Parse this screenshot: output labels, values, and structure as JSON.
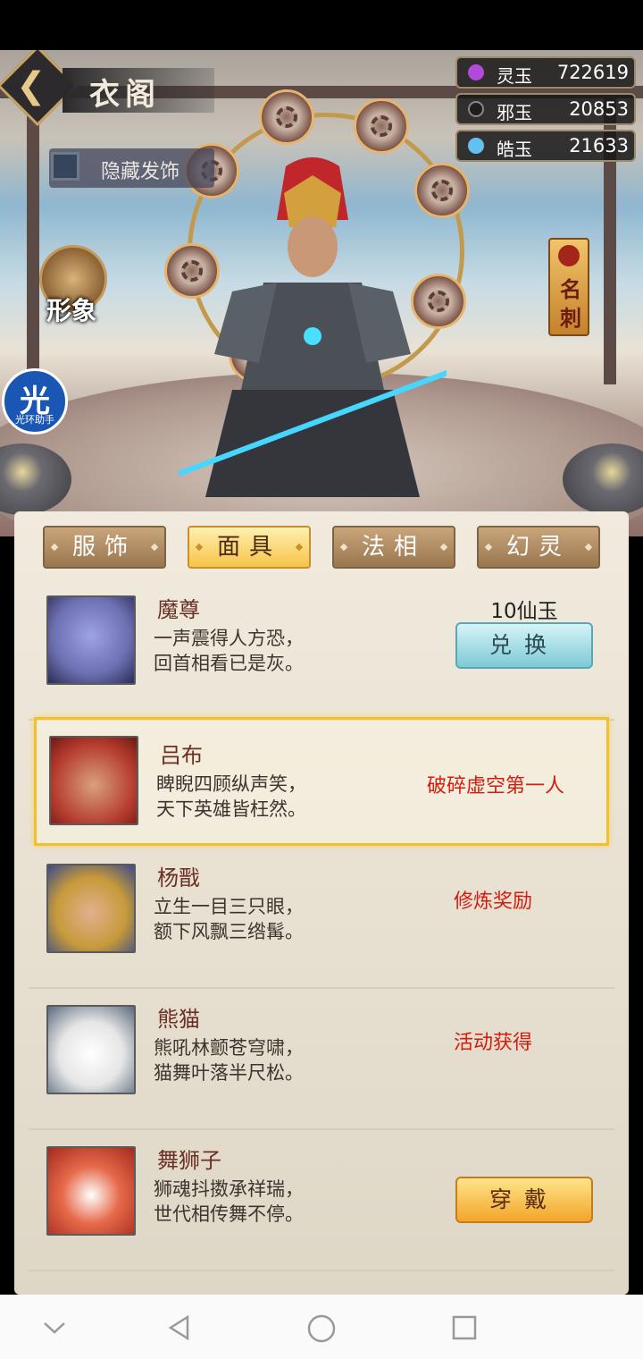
{
  "header": {
    "title": "衣阁",
    "hide_hair_label": "隐藏发饰",
    "resources": [
      {
        "name": "灵玉",
        "value": "722619",
        "icon": "purple-orb-icon",
        "color": "#b14ad8"
      },
      {
        "name": "邪玉",
        "value": "20853",
        "icon": "dark-jade-icon",
        "color": "#1e1e1e"
      },
      {
        "name": "皓玉",
        "value": "21633",
        "icon": "blue-jade-icon",
        "color": "#62c1f1"
      }
    ],
    "portrait_label": "形象",
    "card_label": "名刺",
    "helper_glyph": "光",
    "helper_label": "光环助手"
  },
  "tabs": [
    {
      "label": "服饰",
      "active": false
    },
    {
      "label": "面具",
      "active": true
    },
    {
      "label": "法相",
      "active": false
    },
    {
      "label": "幻灵",
      "active": false
    }
  ],
  "masks": [
    {
      "name": "魔尊",
      "line1": "一声震得人方恐，",
      "line2": "回首相看已是灰。",
      "price": "10仙玉",
      "button": "兑换",
      "avatar_color": "#7e84c9"
    },
    {
      "name": "吕布",
      "line1": "睥睨四顾纵声笑，",
      "line2": "天下英雄皆枉然。",
      "source": "破碎虚空第一人",
      "avatar_color": "#b43a2d"
    },
    {
      "name": "杨戬",
      "line1": "立生一目三只眼，",
      "line2": "额下风飘三绺髯。",
      "source": "修炼奖励",
      "avatar_color": "#c79a3a"
    },
    {
      "name": "熊猫",
      "line1": "熊吼林颤苍穹啸，",
      "line2": "猫舞叶落半尺松。",
      "source": "活动获得",
      "avatar_color": "#f2f2f2"
    },
    {
      "name": "舞狮子",
      "line1": "狮魂抖擞承祥瑞，",
      "line2": "世代相传舞不停。",
      "button": "穿戴",
      "avatar_color": "#d8412e"
    }
  ]
}
